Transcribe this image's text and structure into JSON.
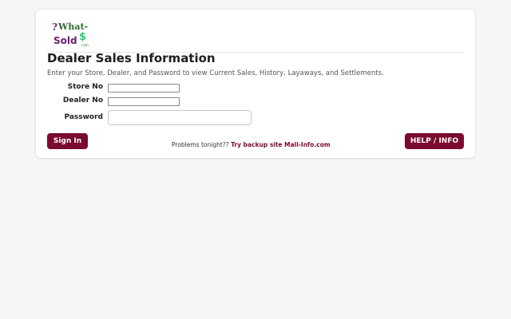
{
  "logo": {
    "text_what": "What-",
    "text_sold": "Sold",
    "text_com": ".com",
    "question_mark": "?",
    "dollar_sign": "$"
  },
  "title": "Dealer Sales Information",
  "subtitle": "Enter your Store, Dealer, and Password to view Current Sales, History, Layaways, and Settlements.",
  "form": {
    "store_label": "Store No",
    "store_value": "",
    "dealer_label": "Dealer No",
    "dealer_value": "",
    "password_label": "Password",
    "password_value": ""
  },
  "buttons": {
    "sign_in": "Sign In",
    "help": "HELP / INFO"
  },
  "problems": {
    "text": "Problems tonight??",
    "link": "Try backup site Mall-Info.com"
  },
  "colors": {
    "accent": "#7a0a2e",
    "logo_green": "#2e8b2e",
    "logo_purple": "#6a1f6e"
  }
}
